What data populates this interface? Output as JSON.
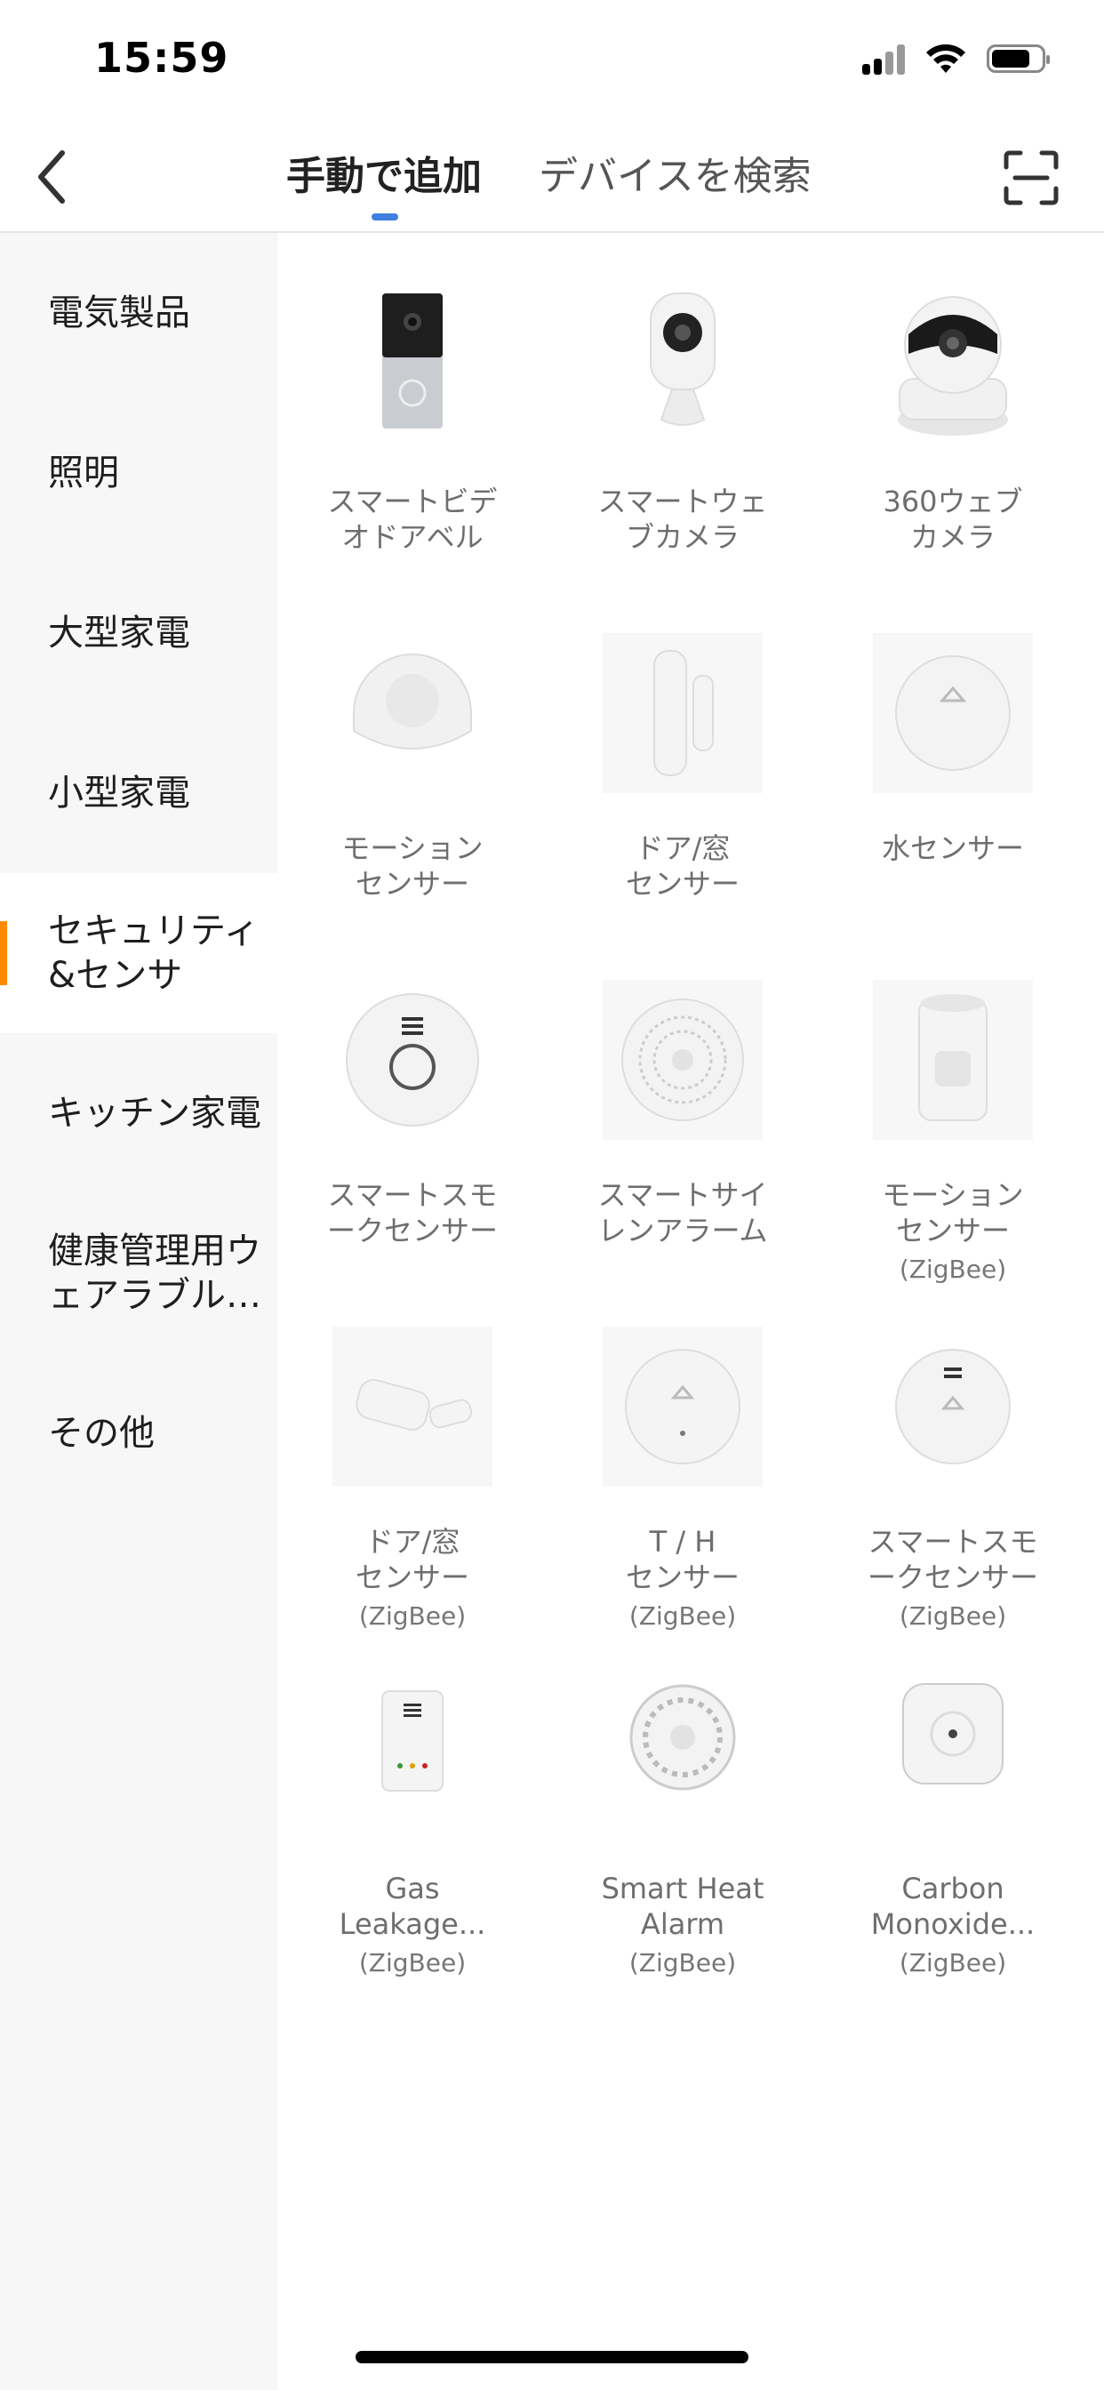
{
  "status_bar": {
    "time": "15:59"
  },
  "header": {
    "tabs": [
      {
        "label": "手動で追加",
        "active": true
      },
      {
        "label": "デバイスを検索",
        "active": false
      }
    ],
    "accent_color": "#3f7fe0"
  },
  "sidebar": {
    "active_color": "#ff8a00",
    "items": [
      {
        "label": "電気製品"
      },
      {
        "label": "照明"
      },
      {
        "label": "大型家電"
      },
      {
        "label": "小型家電"
      },
      {
        "label": "セキュリティ\n&センサ",
        "active": true
      },
      {
        "label": "キッチン家電"
      },
      {
        "label": "健康管理用ウ\nェアラブル…"
      },
      {
        "label": "その他"
      }
    ]
  },
  "devices": [
    {
      "name": "スマートビデ\nオドアベル",
      "sub": "",
      "icon": "doorbell-icon"
    },
    {
      "name": "スマートウェ\nブカメラ",
      "sub": "",
      "icon": "webcam-icon"
    },
    {
      "name": "360ウェブ\nカメラ",
      "sub": "",
      "icon": "ptz-camera-icon"
    },
    {
      "name": "モーション\nセンサー",
      "sub": "",
      "icon": "motion-sensor-icon"
    },
    {
      "name": "ドア/窓\nセンサー",
      "sub": "",
      "icon": "door-sensor-icon"
    },
    {
      "name": "水センサー",
      "sub": "",
      "icon": "water-sensor-icon"
    },
    {
      "name": "スマートスモ\nークセンサー",
      "sub": "",
      "icon": "smoke-sensor-icon"
    },
    {
      "name": "スマートサイ\nレンアラーム",
      "sub": "",
      "icon": "siren-icon"
    },
    {
      "name": "モーション\nセンサー",
      "sub": "(ZigBee)",
      "icon": "motion-sensor-zigbee-icon"
    },
    {
      "name": "ドア/窓\nセンサー",
      "sub": "(ZigBee)",
      "icon": "door-sensor-zigbee-icon"
    },
    {
      "name": "T / H\nセンサー",
      "sub": "(ZigBee)",
      "icon": "th-sensor-icon"
    },
    {
      "name": "スマートスモ\nークセンサー",
      "sub": "(ZigBee)",
      "icon": "smoke-sensor-zigbee-icon"
    },
    {
      "name": "Gas\nLeakage...",
      "sub": "(ZigBee)",
      "icon": "gas-leak-icon"
    },
    {
      "name": "Smart Heat\nAlarm",
      "sub": "(ZigBee)",
      "icon": "heat-alarm-icon"
    },
    {
      "name": "Carbon\nMonoxide...",
      "sub": "(ZigBee)",
      "icon": "co-alarm-icon"
    }
  ]
}
